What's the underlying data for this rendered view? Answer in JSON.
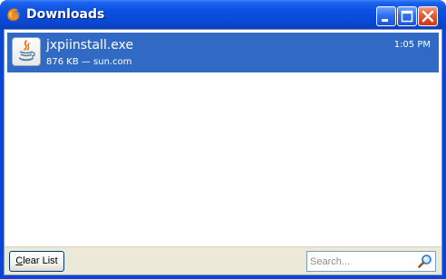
{
  "window": {
    "title": "Downloads",
    "app_icon": "firefox-icon",
    "controls": {
      "minimize_icon": "minimize-icon",
      "maximize_icon": "maximize-icon",
      "close_icon": "close-icon"
    }
  },
  "downloads": [
    {
      "file_name": "jxpiinstall.exe",
      "status": "876 KB — sun.com",
      "time": "1:05 PM",
      "icon": "java-icon",
      "selected": true
    }
  ],
  "footer": {
    "clear_list": {
      "mnemonic": "C",
      "rest": "lear List"
    },
    "search": {
      "placeholder": "Search...",
      "value": "",
      "icon": "magnifier-icon"
    }
  },
  "colors": {
    "titlebar": "#0a49d6",
    "selection": "#316ac5",
    "footer": "#ece9d8"
  }
}
